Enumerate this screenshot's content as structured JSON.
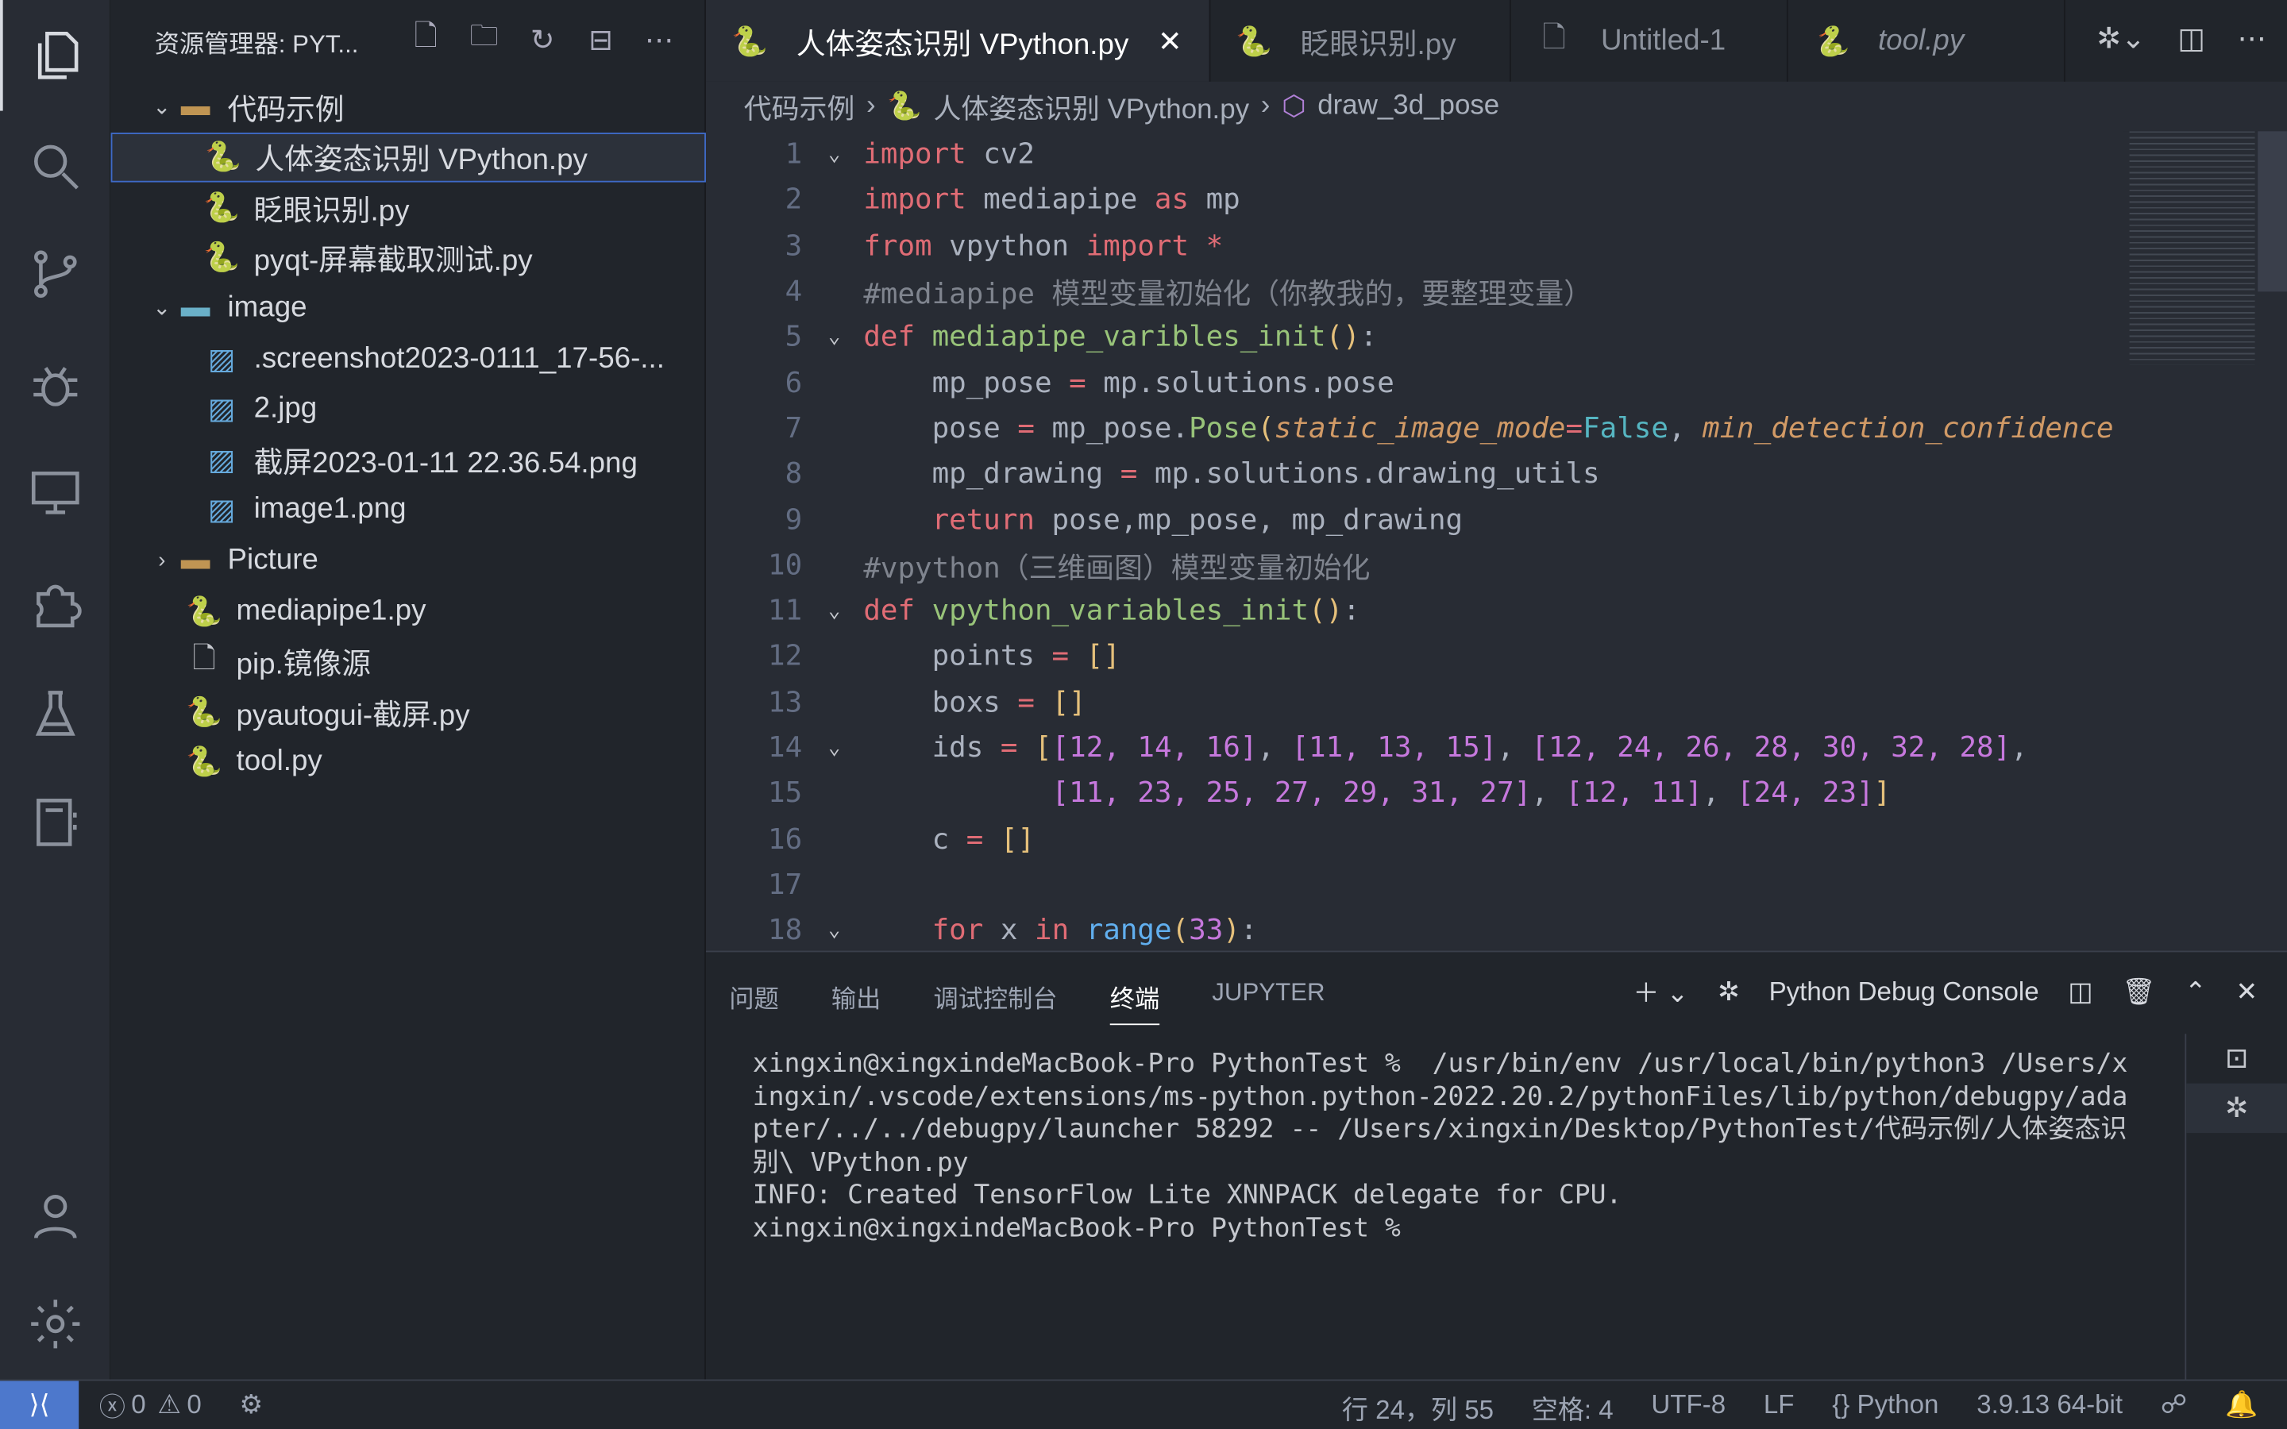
{
  "activity_bar": {
    "items": [
      "explorer",
      "search",
      "source-control",
      "debug",
      "remote-explorer",
      "extensions",
      "testing",
      "notebook"
    ],
    "bottom": [
      "account",
      "settings"
    ]
  },
  "sidebar": {
    "title": "资源管理器: PYT...",
    "items": [
      {
        "label": "代码示例",
        "type": "folder-open",
        "depth": 0
      },
      {
        "label": "人体姿态识别 VPython.py",
        "type": "python",
        "depth": 1,
        "selected": true
      },
      {
        "label": "眨眼识别.py",
        "type": "python",
        "depth": 1
      },
      {
        "label": "pyqt-屏幕截取测试.py",
        "type": "python",
        "depth": 1
      },
      {
        "label": "image",
        "type": "image-folder-open",
        "depth": 0
      },
      {
        "label": ".screenshot2023-0111_17-56-...",
        "type": "image",
        "depth": 1
      },
      {
        "label": "2.jpg",
        "type": "image",
        "depth": 1
      },
      {
        "label": "截屏2023-01-11 22.36.54.png",
        "type": "image",
        "depth": 1
      },
      {
        "label": "image1.png",
        "type": "image",
        "depth": 1
      },
      {
        "label": "Picture",
        "type": "folder",
        "depth": 0
      },
      {
        "label": "mediapipe1.py",
        "type": "python",
        "depth": 0
      },
      {
        "label": "pip.镜像源",
        "type": "file",
        "depth": 0
      },
      {
        "label": "pyautogui-截屏.py",
        "type": "python",
        "depth": 0
      },
      {
        "label": "tool.py",
        "type": "python",
        "depth": 0
      }
    ]
  },
  "tabs": [
    {
      "label": "人体姿态识别 VPython.py",
      "active": true
    },
    {
      "label": "眨眼识别.py"
    },
    {
      "label": "Untitled-1"
    },
    {
      "label": "tool.py",
      "italic": true
    }
  ],
  "breadcrumb": [
    "代码示例",
    "人体姿态识别 VPython.py",
    "draw_3d_pose"
  ],
  "editor": {
    "lines": [
      {
        "n": "1",
        "fold": true,
        "t": [
          [
            "import",
            "kw"
          ],
          [
            " cv2",
            ""
          ]
        ]
      },
      {
        "n": "2",
        "t": [
          [
            "import",
            "kw"
          ],
          [
            " mediapipe ",
            ""
          ],
          [
            "as",
            "kw"
          ],
          [
            " mp",
            ""
          ]
        ]
      },
      {
        "n": "3",
        "t": [
          [
            "from",
            "kw"
          ],
          [
            " vpython ",
            ""
          ],
          [
            "import",
            "kw"
          ],
          [
            " ",
            ""
          ],
          [
            "*",
            "op"
          ]
        ]
      },
      {
        "n": "4",
        "t": [
          [
            "#mediapipe 模型变量初始化（你教我的，要整理变量）",
            "cm"
          ]
        ]
      },
      {
        "n": "5",
        "fold": true,
        "t": [
          [
            "def",
            "kw"
          ],
          [
            " ",
            ""
          ],
          [
            "mediapipe_varibles_init",
            "fn"
          ],
          [
            "()",
            "by"
          ],
          [
            ":",
            ""
          ]
        ]
      },
      {
        "n": "6",
        "t": [
          [
            "    mp_pose ",
            ""
          ],
          [
            "=",
            "op"
          ],
          [
            " mp.solutions.pose",
            ""
          ]
        ]
      },
      {
        "n": "7",
        "t": [
          [
            "    pose ",
            ""
          ],
          [
            "=",
            "op"
          ],
          [
            " mp_pose.",
            ""
          ],
          [
            "Pose",
            "fn"
          ],
          [
            "(",
            "by"
          ],
          [
            "static_image_mode",
            "pa"
          ],
          [
            "=",
            "op"
          ],
          [
            "False",
            "bool"
          ],
          [
            ", ",
            ""
          ],
          [
            "min_detection_confidence",
            "pa"
          ]
        ]
      },
      {
        "n": "8",
        "t": [
          [
            "    mp_drawing ",
            ""
          ],
          [
            "=",
            "op"
          ],
          [
            " mp.solutions.drawing_utils",
            ""
          ]
        ]
      },
      {
        "n": "9",
        "t": [
          [
            "    ",
            ""
          ],
          [
            "return",
            "kw"
          ],
          [
            " pose,mp_pose, mp_drawing",
            ""
          ]
        ]
      },
      {
        "n": "10",
        "t": [
          [
            "#vpython（三维画图）模型变量初始化",
            "cm"
          ]
        ]
      },
      {
        "n": "11",
        "fold": true,
        "t": [
          [
            "def",
            "kw"
          ],
          [
            " ",
            ""
          ],
          [
            "vpython_variables_init",
            "fn"
          ],
          [
            "()",
            "by"
          ],
          [
            ":",
            ""
          ]
        ]
      },
      {
        "n": "12",
        "t": [
          [
            "    points ",
            ""
          ],
          [
            "=",
            "op"
          ],
          [
            " ",
            ""
          ],
          [
            "[]",
            "by"
          ]
        ]
      },
      {
        "n": "13",
        "t": [
          [
            "    boxs ",
            ""
          ],
          [
            "=",
            "op"
          ],
          [
            " ",
            ""
          ],
          [
            "[]",
            "by"
          ]
        ]
      },
      {
        "n": "14",
        "fold": true,
        "t": [
          [
            "    ids ",
            ""
          ],
          [
            "=",
            "op"
          ],
          [
            " ",
            ""
          ],
          [
            "[",
            "by"
          ],
          [
            "[12, 14, 16]",
            "bp"
          ],
          [
            ", ",
            ""
          ],
          [
            "[11, 13, 15]",
            "bp"
          ],
          [
            ", ",
            ""
          ],
          [
            "[12, 24, 26, 28, 30, 32, 28]",
            "bp"
          ],
          [
            ",",
            ""
          ]
        ]
      },
      {
        "n": "15",
        "t": [
          [
            "           ",
            ""
          ],
          [
            "[11, 23, 25, 27, 29, 31, 27]",
            "bp"
          ],
          [
            ", ",
            ""
          ],
          [
            "[12, 11]",
            "bp"
          ],
          [
            ", ",
            ""
          ],
          [
            "[24, 23]",
            "bp"
          ],
          [
            "]",
            "by"
          ]
        ]
      },
      {
        "n": "16",
        "t": [
          [
            "    c ",
            ""
          ],
          [
            "=",
            "op"
          ],
          [
            " ",
            ""
          ],
          [
            "[]",
            "by"
          ]
        ]
      },
      {
        "n": "17",
        "t": []
      },
      {
        "n": "18",
        "fold": true,
        "t": [
          [
            "    ",
            ""
          ],
          [
            "for",
            "kw"
          ],
          [
            " x ",
            ""
          ],
          [
            "in",
            "kw"
          ],
          [
            " ",
            ""
          ],
          [
            "range",
            "bb"
          ],
          [
            "(",
            "by"
          ],
          [
            "33",
            "num"
          ],
          [
            ")",
            "by"
          ],
          [
            ":",
            ""
          ]
        ]
      }
    ]
  },
  "panel": {
    "tabs": [
      "问题",
      "输出",
      "调试控制台",
      "终端",
      "JUPYTER"
    ],
    "active_tab": "终端",
    "terminal_name": "Python Debug Console",
    "terminal_text": "xingxin@xingxindeMacBook-Pro PythonTest %  /usr/bin/env /usr/local/bin/python3 /Users/xingxin/.vscode/extensions/ms-python.python-2022.20.2/pythonFiles/lib/python/debugpy/adapter/../../debugpy/launcher 58292 -- /Users/xingxin/Desktop/PythonTest/代码示例/人体姿态识别\\ VPython.py\nINFO: Created TensorFlow Lite XNNPACK delegate for CPU.\nxingxin@xingxindeMacBook-Pro PythonTest % "
  },
  "status": {
    "errors": "0",
    "warnings": "0",
    "position": "行 24，列 55",
    "spaces": "空格: 4",
    "encoding": "UTF-8",
    "eol": "LF",
    "language": "Python",
    "interpreter": "3.9.13 64-bit"
  },
  "colors": {
    "accent": "#4d78cc",
    "python_blue": "#3b77a8",
    "python_yellow": "#f5c842"
  }
}
